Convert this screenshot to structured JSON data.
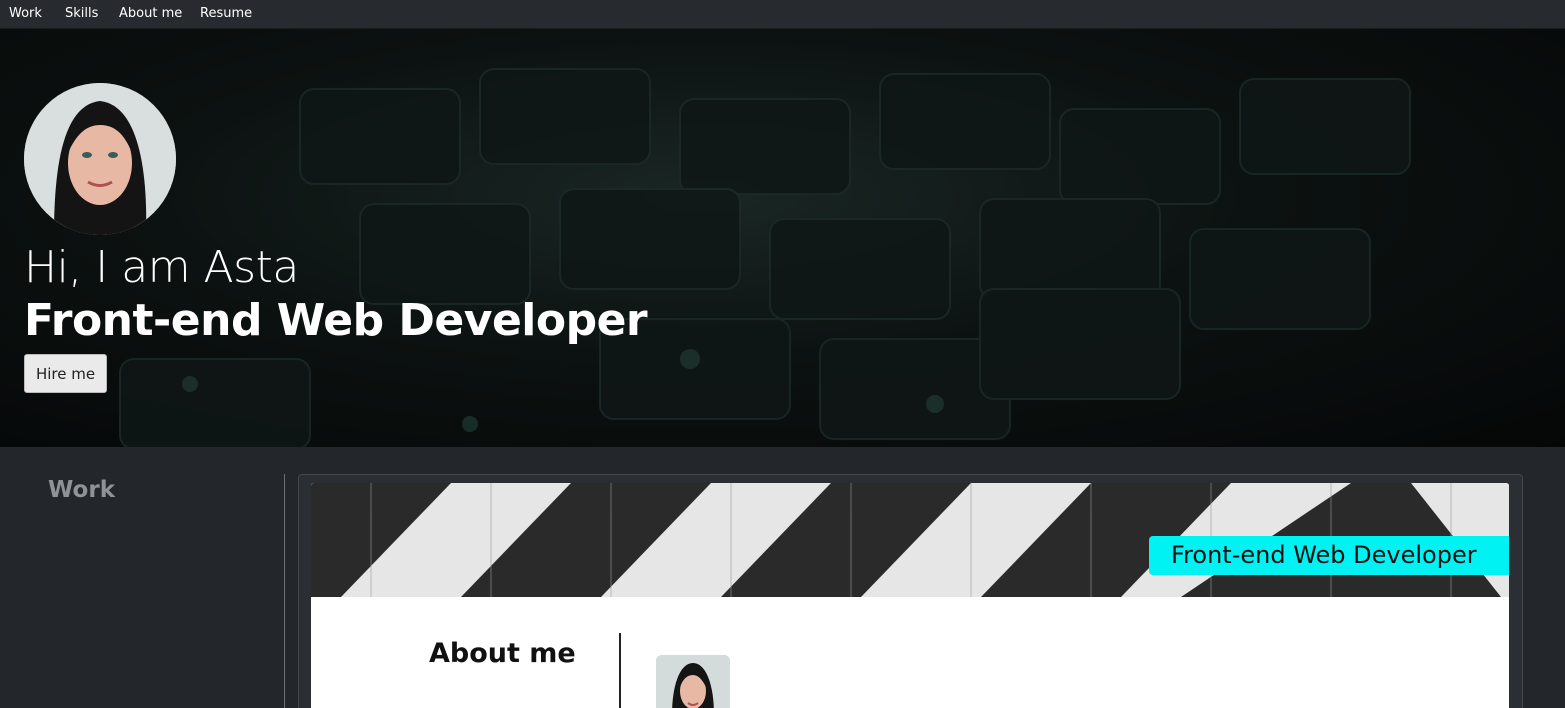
{
  "nav": {
    "items": [
      {
        "label": "Work"
      },
      {
        "label": "Skills"
      },
      {
        "label": "About me"
      },
      {
        "label": "Resume"
      }
    ]
  },
  "hero": {
    "greeting": "Hi, I am Asta",
    "role": "Front-end Web Developer",
    "hire_button": "Hire me"
  },
  "work": {
    "section_title": "Work",
    "project": {
      "banner_tag": "Front-end Web Developer",
      "about_title": "About me"
    }
  },
  "colors": {
    "page_bg": "#23272b",
    "nav_bg": "#272b30",
    "banner_tag_bg": "#00f2f2"
  }
}
